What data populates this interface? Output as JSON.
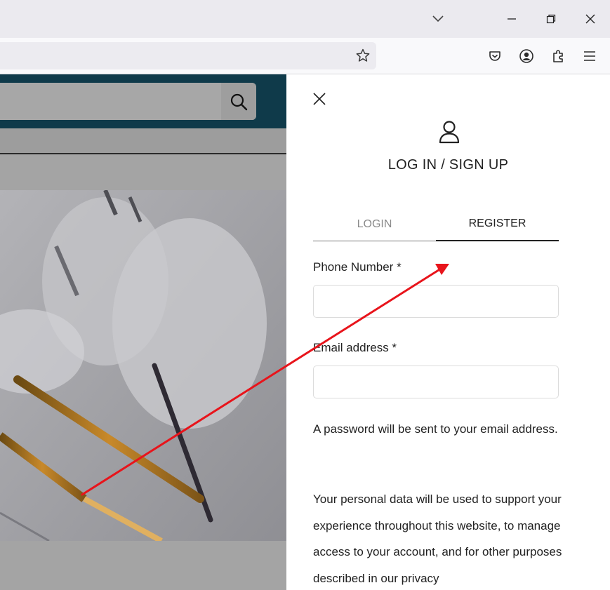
{
  "browser": {
    "controls": [
      "list-all-tabs",
      "minimize",
      "restore",
      "close"
    ],
    "toolbar_icons": [
      "pocket-icon",
      "account-icon",
      "extensions-icon",
      "menu-icon"
    ]
  },
  "modal": {
    "title": "LOG IN / SIGN UP",
    "tabs": [
      {
        "label": "LOGIN",
        "active": false
      },
      {
        "label": "REGISTER",
        "active": true
      }
    ],
    "fields": {
      "phone": {
        "label": "Phone Number *",
        "value": "",
        "placeholder": ""
      },
      "email": {
        "label": "Email address  *",
        "value": "",
        "placeholder": ""
      }
    },
    "password_note": "A password will be sent to your email address.",
    "privacy_note": "Your personal data will be used to support your experience throughout this website, to manage access to your account, and for other purposes described in our privacy"
  },
  "colors": {
    "site_header": "#0f3a4a",
    "overlay": "#a4a4a4",
    "annotation_arrow": "#e8141b",
    "accent": "#222222"
  }
}
